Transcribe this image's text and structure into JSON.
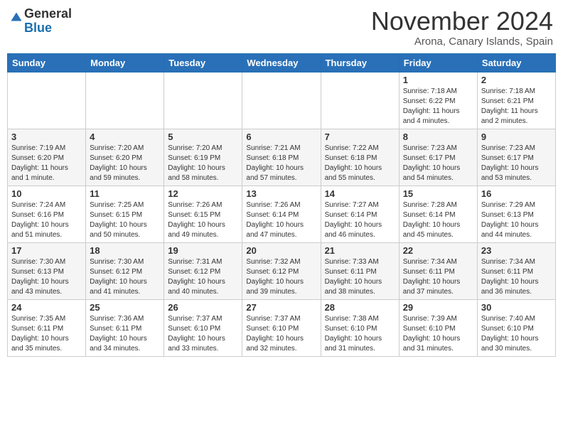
{
  "header": {
    "logo_general": "General",
    "logo_blue": "Blue",
    "month": "November 2024",
    "location": "Arona, Canary Islands, Spain"
  },
  "weekdays": [
    "Sunday",
    "Monday",
    "Tuesday",
    "Wednesday",
    "Thursday",
    "Friday",
    "Saturday"
  ],
  "weeks": [
    [
      {
        "day": "",
        "info": ""
      },
      {
        "day": "",
        "info": ""
      },
      {
        "day": "",
        "info": ""
      },
      {
        "day": "",
        "info": ""
      },
      {
        "day": "",
        "info": ""
      },
      {
        "day": "1",
        "info": "Sunrise: 7:18 AM\nSunset: 6:22 PM\nDaylight: 11 hours and 4 minutes."
      },
      {
        "day": "2",
        "info": "Sunrise: 7:18 AM\nSunset: 6:21 PM\nDaylight: 11 hours and 2 minutes."
      }
    ],
    [
      {
        "day": "3",
        "info": "Sunrise: 7:19 AM\nSunset: 6:20 PM\nDaylight: 11 hours and 1 minute."
      },
      {
        "day": "4",
        "info": "Sunrise: 7:20 AM\nSunset: 6:20 PM\nDaylight: 10 hours and 59 minutes."
      },
      {
        "day": "5",
        "info": "Sunrise: 7:20 AM\nSunset: 6:19 PM\nDaylight: 10 hours and 58 minutes."
      },
      {
        "day": "6",
        "info": "Sunrise: 7:21 AM\nSunset: 6:18 PM\nDaylight: 10 hours and 57 minutes."
      },
      {
        "day": "7",
        "info": "Sunrise: 7:22 AM\nSunset: 6:18 PM\nDaylight: 10 hours and 55 minutes."
      },
      {
        "day": "8",
        "info": "Sunrise: 7:23 AM\nSunset: 6:17 PM\nDaylight: 10 hours and 54 minutes."
      },
      {
        "day": "9",
        "info": "Sunrise: 7:23 AM\nSunset: 6:17 PM\nDaylight: 10 hours and 53 minutes."
      }
    ],
    [
      {
        "day": "10",
        "info": "Sunrise: 7:24 AM\nSunset: 6:16 PM\nDaylight: 10 hours and 51 minutes."
      },
      {
        "day": "11",
        "info": "Sunrise: 7:25 AM\nSunset: 6:15 PM\nDaylight: 10 hours and 50 minutes."
      },
      {
        "day": "12",
        "info": "Sunrise: 7:26 AM\nSunset: 6:15 PM\nDaylight: 10 hours and 49 minutes."
      },
      {
        "day": "13",
        "info": "Sunrise: 7:26 AM\nSunset: 6:14 PM\nDaylight: 10 hours and 47 minutes."
      },
      {
        "day": "14",
        "info": "Sunrise: 7:27 AM\nSunset: 6:14 PM\nDaylight: 10 hours and 46 minutes."
      },
      {
        "day": "15",
        "info": "Sunrise: 7:28 AM\nSunset: 6:14 PM\nDaylight: 10 hours and 45 minutes."
      },
      {
        "day": "16",
        "info": "Sunrise: 7:29 AM\nSunset: 6:13 PM\nDaylight: 10 hours and 44 minutes."
      }
    ],
    [
      {
        "day": "17",
        "info": "Sunrise: 7:30 AM\nSunset: 6:13 PM\nDaylight: 10 hours and 43 minutes."
      },
      {
        "day": "18",
        "info": "Sunrise: 7:30 AM\nSunset: 6:12 PM\nDaylight: 10 hours and 41 minutes."
      },
      {
        "day": "19",
        "info": "Sunrise: 7:31 AM\nSunset: 6:12 PM\nDaylight: 10 hours and 40 minutes."
      },
      {
        "day": "20",
        "info": "Sunrise: 7:32 AM\nSunset: 6:12 PM\nDaylight: 10 hours and 39 minutes."
      },
      {
        "day": "21",
        "info": "Sunrise: 7:33 AM\nSunset: 6:11 PM\nDaylight: 10 hours and 38 minutes."
      },
      {
        "day": "22",
        "info": "Sunrise: 7:34 AM\nSunset: 6:11 PM\nDaylight: 10 hours and 37 minutes."
      },
      {
        "day": "23",
        "info": "Sunrise: 7:34 AM\nSunset: 6:11 PM\nDaylight: 10 hours and 36 minutes."
      }
    ],
    [
      {
        "day": "24",
        "info": "Sunrise: 7:35 AM\nSunset: 6:11 PM\nDaylight: 10 hours and 35 minutes."
      },
      {
        "day": "25",
        "info": "Sunrise: 7:36 AM\nSunset: 6:11 PM\nDaylight: 10 hours and 34 minutes."
      },
      {
        "day": "26",
        "info": "Sunrise: 7:37 AM\nSunset: 6:10 PM\nDaylight: 10 hours and 33 minutes."
      },
      {
        "day": "27",
        "info": "Sunrise: 7:37 AM\nSunset: 6:10 PM\nDaylight: 10 hours and 32 minutes."
      },
      {
        "day": "28",
        "info": "Sunrise: 7:38 AM\nSunset: 6:10 PM\nDaylight: 10 hours and 31 minutes."
      },
      {
        "day": "29",
        "info": "Sunrise: 7:39 AM\nSunset: 6:10 PM\nDaylight: 10 hours and 31 minutes."
      },
      {
        "day": "30",
        "info": "Sunrise: 7:40 AM\nSunset: 6:10 PM\nDaylight: 10 hours and 30 minutes."
      }
    ]
  ]
}
